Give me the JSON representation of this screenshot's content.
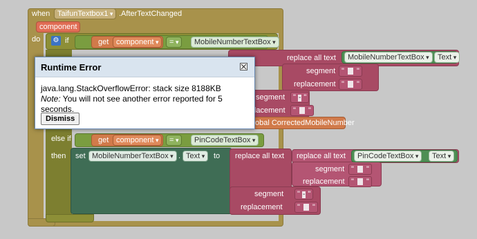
{
  "event": {
    "when": "when",
    "component": "TaifunTextbox1",
    "event_name": ".AfterTextChanged",
    "param": "component",
    "do": "do"
  },
  "if_block": {
    "if_label": "if",
    "else_if_label": "else if",
    "then_label": "then"
  },
  "condition1": {
    "get": "get",
    "var": "component",
    "op": "=",
    "target": "MobileNumberTextBox"
  },
  "condition2": {
    "get": "get",
    "var": "component",
    "op": "=",
    "target": "PinCodeTextBox"
  },
  "top_branch": {
    "replace_all_text": "replace all text",
    "component": "MobileNumberTextBox",
    "property": "Text",
    "segment": "segment",
    "replacement": "replacement",
    "dash": "-",
    "global_var": "obal CorrectedMobileNumber"
  },
  "bottom_branch": {
    "set": "set",
    "component": "MobileNumberTextBox",
    "property": "Text",
    "to": "to",
    "replace_all_text_outer": "replace all text",
    "replace_all_text_inner": "replace all text",
    "inner_component": "PinCodeTextBox",
    "inner_property": "Text",
    "segment": "segment",
    "replacement": "replacement",
    "dash": "-"
  },
  "dialog": {
    "title": "Runtime Error",
    "error_line": "java.lang.StackOverflowError: stack size 8188KB",
    "note_label": "Note:",
    "note_text": " You will not see another error reported for 5 seconds.",
    "dismiss": "Dismiss"
  }
}
